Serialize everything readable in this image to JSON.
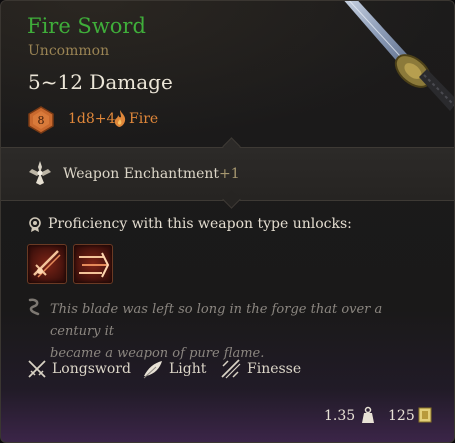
{
  "item": {
    "name": "Fire Sword",
    "rarity": "Uncommon",
    "damage_range": "5~12 Damage",
    "dice_face": "8",
    "damage_roll": "1d8+4",
    "damage_type": "Fire"
  },
  "enchantment": {
    "label": "Weapon Enchantment",
    "bonus": "+1"
  },
  "proficiency": {
    "label": "Proficiency with this weapon type unlocks:",
    "actions": [
      "slash-action-icon",
      "pommel-strike-action-icon"
    ]
  },
  "lore": {
    "line1": "This blade was left so long in the forge that over a century it",
    "line2": "became a weapon of pure flame."
  },
  "properties": [
    {
      "label": "Longsword",
      "icon": "longsword-icon"
    },
    {
      "label": "Light",
      "icon": "feather-icon"
    },
    {
      "label": "Finesse",
      "icon": "finesse-icon"
    }
  ],
  "footer": {
    "weight": "1.35",
    "value": "125"
  },
  "colors": {
    "name_green": "#3fae3a",
    "rarity_gold": "#9a8454",
    "fire_orange": "#e0873a"
  }
}
